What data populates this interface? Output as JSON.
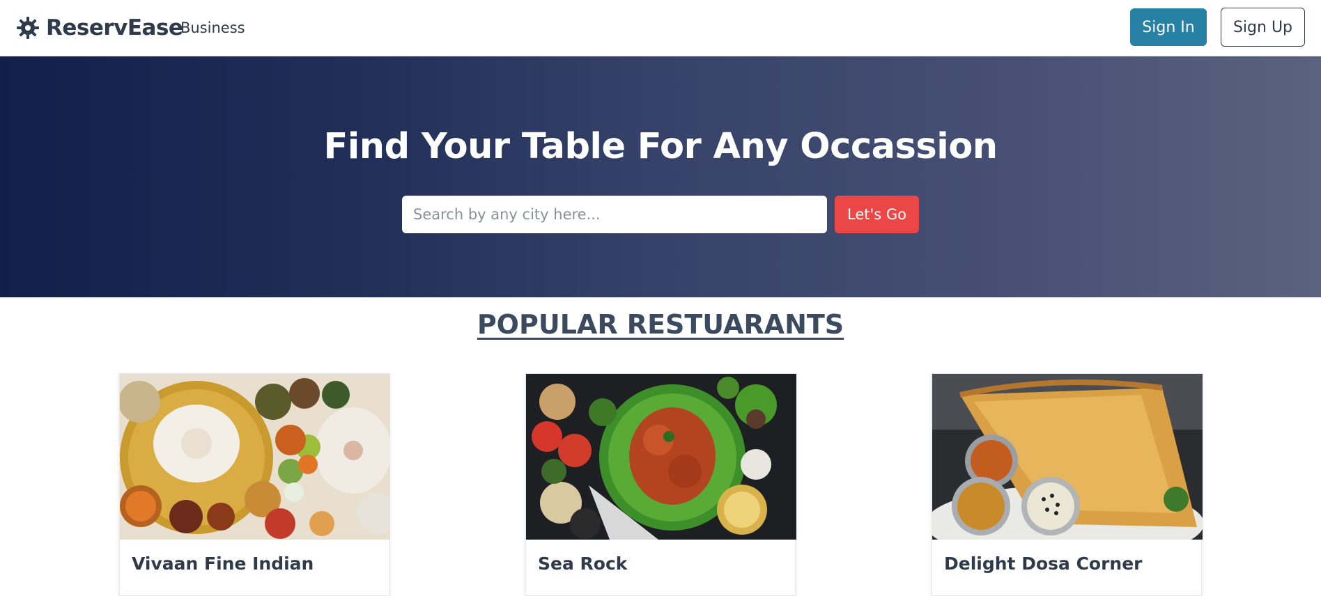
{
  "navbar": {
    "brand_name": "ReservEase",
    "logo_icon": "gear-icon",
    "link_business": "Business",
    "signin_label": "Sign In",
    "signup_label": "Sign Up",
    "signin_color": "#2681a4"
  },
  "hero": {
    "title": "Find Your Table For Any Occassion",
    "search_placeholder": "Search by any city here...",
    "search_value": "",
    "go_label": "Let's Go",
    "go_color": "#ec4747"
  },
  "popular": {
    "title": "POPULAR RESTUARANTS",
    "cards": [
      {
        "name": "Vivaan Fine Indian"
      },
      {
        "name": "Sea Rock"
      },
      {
        "name": "Delight Dosa Corner"
      }
    ]
  }
}
